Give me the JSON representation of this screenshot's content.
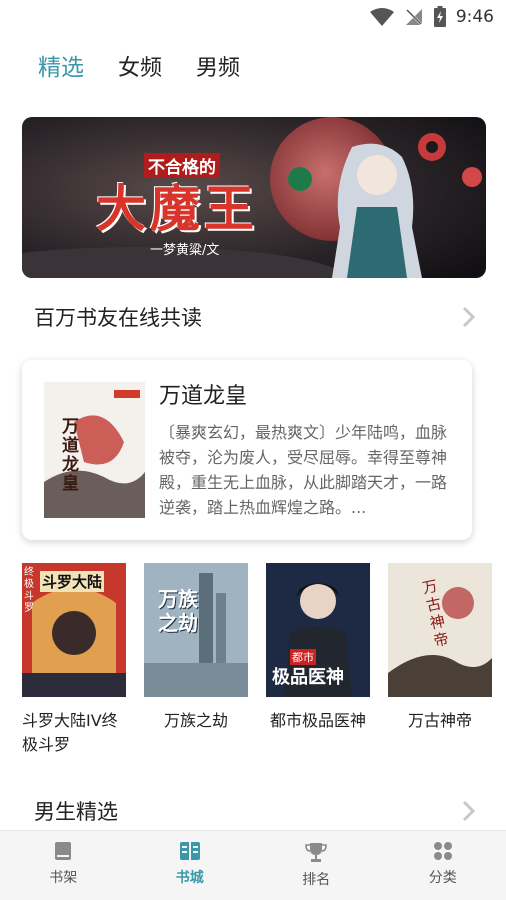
{
  "status": {
    "time": "9:46"
  },
  "tabs": [
    {
      "label": "精选",
      "active": true
    },
    {
      "label": "女频",
      "active": false
    },
    {
      "label": "男频",
      "active": false
    }
  ],
  "banner": {
    "title_small": "不合格的",
    "title_big": "大魔王",
    "author": "一梦黄粱/文"
  },
  "section1": {
    "title": "百万书友在线共读"
  },
  "featured": {
    "title": "万道龙皇",
    "description": "〔暴爽玄幻，最热爽文〕少年陆鸣，血脉被夺，沦为废人，受尽屈辱。幸得至尊神殿，重生无上血脉，从此脚踏天才，一路逆袭，踏上热血辉煌之路。...",
    "cover_text": "万道龙皇"
  },
  "books": [
    {
      "title": "斗罗大陆IV终极斗罗",
      "cover_text": "斗罗大陆",
      "cover_side": "终极斗罗"
    },
    {
      "title": "万族之劫",
      "cover_text": "万族之劫"
    },
    {
      "title": "都市极品医神",
      "cover_text": "极品医神",
      "cover_tag": "都市"
    },
    {
      "title": "万古神帝",
      "cover_text": "万古神帝"
    }
  ],
  "section2": {
    "title": "男生精选"
  },
  "bottom_nav": [
    {
      "label": "书架",
      "icon": "bookshelf-icon",
      "active": false
    },
    {
      "label": "书城",
      "icon": "bookstore-icon",
      "active": true
    },
    {
      "label": "排名",
      "icon": "trophy-icon",
      "active": false
    },
    {
      "label": "分类",
      "icon": "category-icon",
      "active": false
    }
  ],
  "colors": {
    "accent": "#3a98a8",
    "text": "#222222",
    "muted": "#666666"
  }
}
